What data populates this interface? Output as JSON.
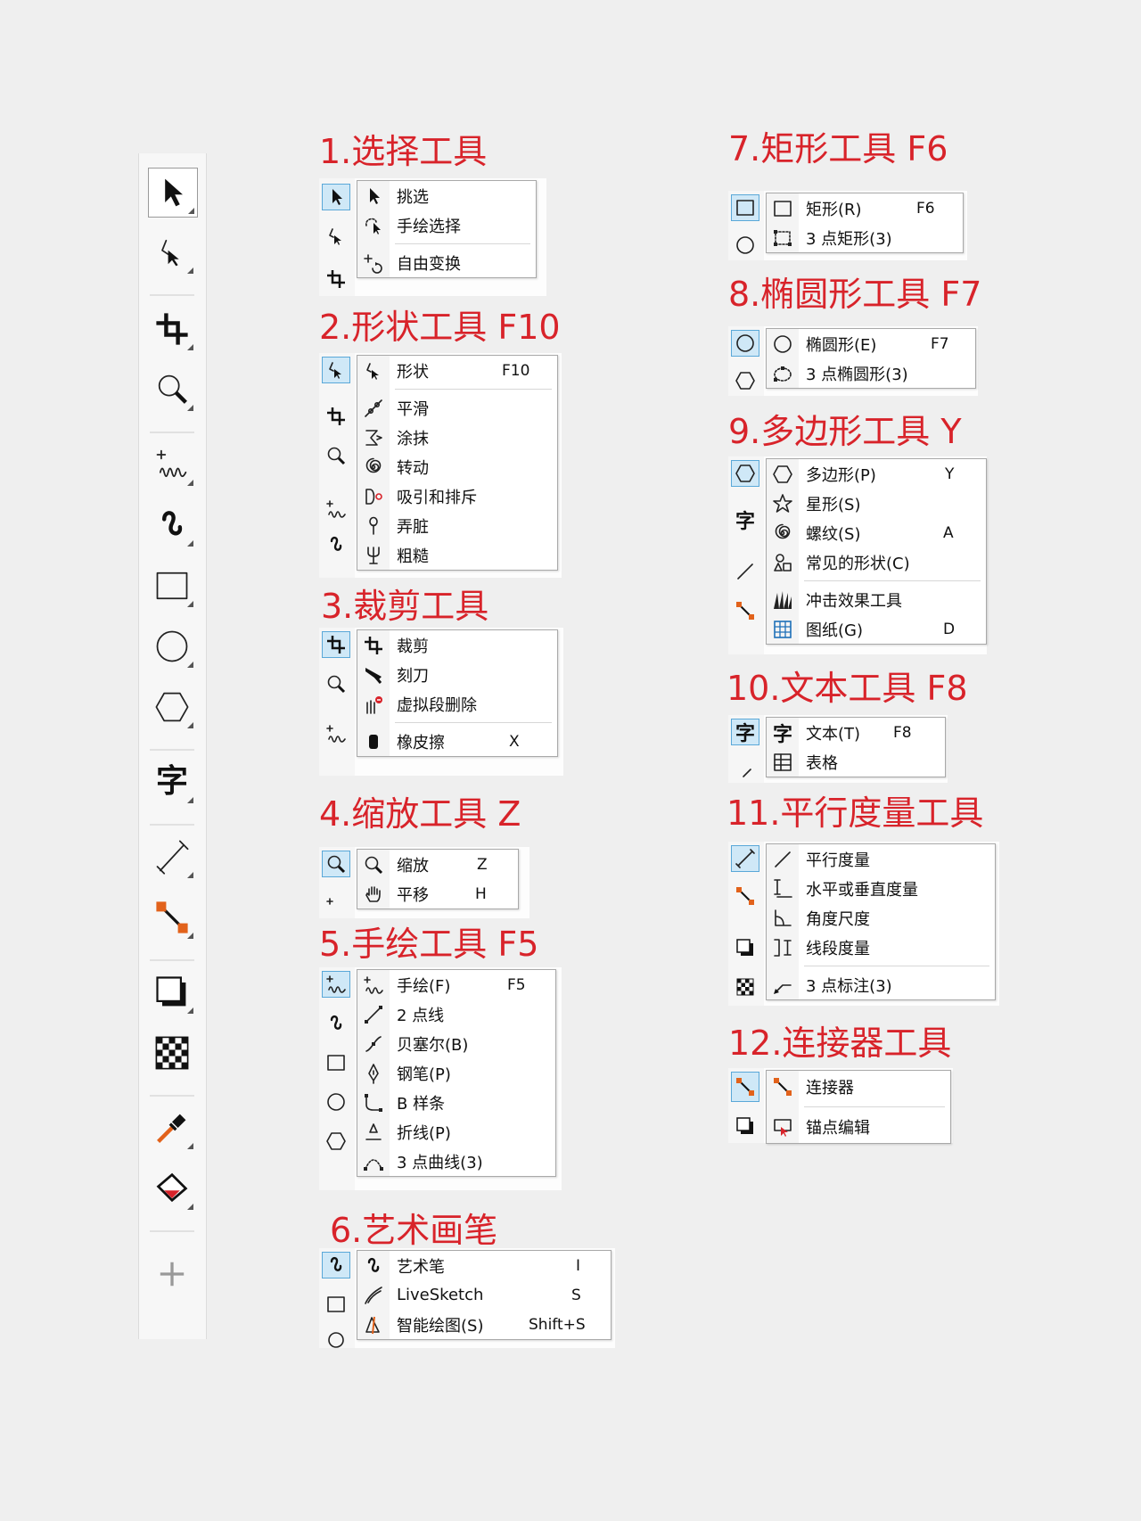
{
  "accent_color": "#d8232a",
  "selection_color": "#5aa8d8",
  "toolbox": {
    "tools": [
      "pick-icon",
      "shape-icon",
      "crop-icon",
      "zoom-icon",
      "freehand-icon",
      "artistic-media-icon",
      "rectangle-icon",
      "ellipse-icon",
      "polygon-icon",
      "text-icon",
      "parallel-dimension-icon",
      "connector-icon",
      "drop-shadow-icon",
      "transparency-icon",
      "color-eyedropper-icon",
      "interactive-fill-icon",
      "add-icon"
    ]
  },
  "sections": {
    "s1": {
      "title": "1.选择工具",
      "items": [
        {
          "label": "挑选",
          "key": ""
        },
        {
          "label": "手绘选择",
          "key": ""
        },
        {
          "label": "自由变换",
          "key": ""
        }
      ]
    },
    "s2": {
      "title": "2.形状工具 F10",
      "items": [
        {
          "label": "形状",
          "key": "F10"
        },
        {
          "label": "平滑",
          "key": ""
        },
        {
          "label": "涂抹",
          "key": ""
        },
        {
          "label": "转动",
          "key": ""
        },
        {
          "label": "吸引和排斥",
          "key": ""
        },
        {
          "label": "弄脏",
          "key": ""
        },
        {
          "label": "粗糙",
          "key": ""
        }
      ]
    },
    "s3": {
      "title": "3.裁剪工具",
      "items": [
        {
          "label": "裁剪",
          "key": ""
        },
        {
          "label": "刻刀",
          "key": ""
        },
        {
          "label": "虚拟段删除",
          "key": ""
        },
        {
          "label": "橡皮擦",
          "key": "X"
        }
      ]
    },
    "s4": {
      "title": "4.缩放工具 Z",
      "items": [
        {
          "label": "缩放",
          "key": "Z"
        },
        {
          "label": "平移",
          "key": "H"
        }
      ]
    },
    "s5": {
      "title": "5.手绘工具 F5",
      "items": [
        {
          "label": "手绘(F)",
          "key": "F5"
        },
        {
          "label": "2 点线",
          "key": ""
        },
        {
          "label": "贝塞尔(B)",
          "key": ""
        },
        {
          "label": "钢笔(P)",
          "key": ""
        },
        {
          "label": "B 样条",
          "key": ""
        },
        {
          "label": "折线(P)",
          "key": ""
        },
        {
          "label": "3 点曲线(3)",
          "key": ""
        }
      ]
    },
    "s6": {
      "title": "6.艺术画笔",
      "items": [
        {
          "label": "艺术笔",
          "key": "I"
        },
        {
          "label": "LiveSketch",
          "key": "S"
        },
        {
          "label": "智能绘图(S)",
          "key": "Shift+S"
        }
      ]
    },
    "s7": {
      "title": "7.矩形工具 F6",
      "items": [
        {
          "label": "矩形(R)",
          "key": "F6"
        },
        {
          "label": "3 点矩形(3)",
          "key": ""
        }
      ]
    },
    "s8": {
      "title": "8.椭圆形工具 F7",
      "items": [
        {
          "label": "椭圆形(E)",
          "key": "F7"
        },
        {
          "label": "3 点椭圆形(3)",
          "key": ""
        }
      ]
    },
    "s9": {
      "title": "9.多边形工具 Y",
      "items": [
        {
          "label": "多边形(P)",
          "key": "Y"
        },
        {
          "label": "星形(S)",
          "key": ""
        },
        {
          "label": "螺纹(S)",
          "key": "A"
        },
        {
          "label": "常见的形状(C)",
          "key": ""
        },
        {
          "label": "冲击效果工具",
          "key": ""
        },
        {
          "label": "图纸(G)",
          "key": "D"
        }
      ]
    },
    "s10": {
      "title": "10.文本工具 F8",
      "items": [
        {
          "label": "文本(T)",
          "key": "F8"
        },
        {
          "label": "表格",
          "key": ""
        }
      ]
    },
    "s11": {
      "title": "11.平行度量工具",
      "items": [
        {
          "label": "平行度量",
          "key": ""
        },
        {
          "label": "水平或垂直度量",
          "key": ""
        },
        {
          "label": "角度尺度",
          "key": ""
        },
        {
          "label": "线段度量",
          "key": ""
        },
        {
          "label": "3 点标注(3)",
          "key": ""
        }
      ]
    },
    "s12": {
      "title": "12.连接器工具",
      "items": [
        {
          "label": "连接器",
          "key": ""
        },
        {
          "label": "锚点编辑",
          "key": ""
        }
      ]
    },
    "text_glyph": "字"
  }
}
